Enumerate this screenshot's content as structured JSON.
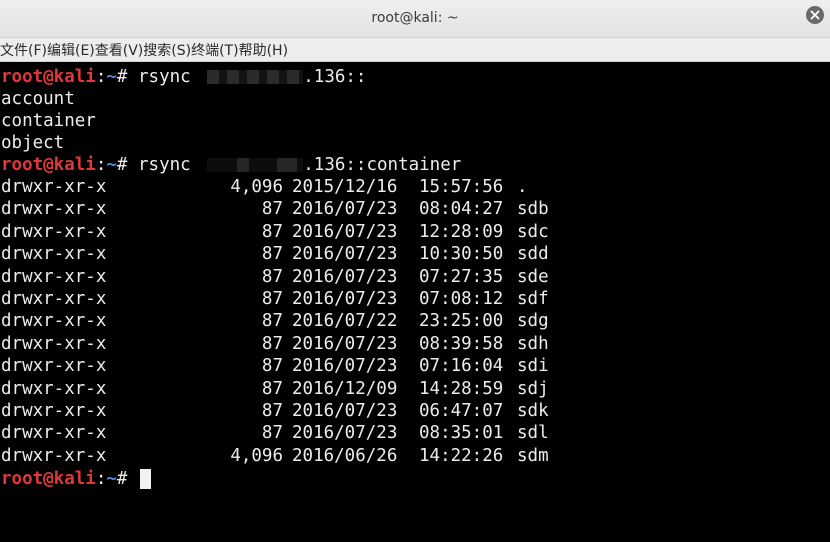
{
  "window": {
    "title": "root@kali: ~"
  },
  "menu": [
    {
      "label": "文件(F)"
    },
    {
      "label": "编辑(E)"
    },
    {
      "label": "查看(V)"
    },
    {
      "label": "搜索(S)"
    },
    {
      "label": "终端(T)"
    },
    {
      "label": "帮助(H)"
    }
  ],
  "prompt": {
    "user": "root@kali",
    "sep": ":",
    "path": "~",
    "symbol": "#"
  },
  "commands": [
    {
      "cmd": "rsync",
      "after_redaction": ".136::"
    },
    {
      "cmd": "rsync",
      "after_redaction": ".136::container"
    }
  ],
  "modules": [
    "account",
    "container",
    "object"
  ],
  "listing": [
    {
      "perms": "drwxr-xr-x",
      "size": "4,096",
      "date": "2015/12/16",
      "time": "15:57:56",
      "name": "."
    },
    {
      "perms": "drwxr-xr-x",
      "size": "87",
      "date": "2016/07/23",
      "time": "08:04:27",
      "name": "sdb"
    },
    {
      "perms": "drwxr-xr-x",
      "size": "87",
      "date": "2016/07/23",
      "time": "12:28:09",
      "name": "sdc"
    },
    {
      "perms": "drwxr-xr-x",
      "size": "87",
      "date": "2016/07/23",
      "time": "10:30:50",
      "name": "sdd"
    },
    {
      "perms": "drwxr-xr-x",
      "size": "87",
      "date": "2016/07/23",
      "time": "07:27:35",
      "name": "sde"
    },
    {
      "perms": "drwxr-xr-x",
      "size": "87",
      "date": "2016/07/23",
      "time": "07:08:12",
      "name": "sdf"
    },
    {
      "perms": "drwxr-xr-x",
      "size": "87",
      "date": "2016/07/22",
      "time": "23:25:00",
      "name": "sdg"
    },
    {
      "perms": "drwxr-xr-x",
      "size": "87",
      "date": "2016/07/23",
      "time": "08:39:58",
      "name": "sdh"
    },
    {
      "perms": "drwxr-xr-x",
      "size": "87",
      "date": "2016/07/23",
      "time": "07:16:04",
      "name": "sdi"
    },
    {
      "perms": "drwxr-xr-x",
      "size": "87",
      "date": "2016/12/09",
      "time": "14:28:59",
      "name": "sdj"
    },
    {
      "perms": "drwxr-xr-x",
      "size": "87",
      "date": "2016/07/23",
      "time": "06:47:07",
      "name": "sdk"
    },
    {
      "perms": "drwxr-xr-x",
      "size": "87",
      "date": "2016/07/23",
      "time": "08:35:01",
      "name": "sdl"
    },
    {
      "perms": "drwxr-xr-x",
      "size": "4,096",
      "date": "2016/06/26",
      "time": "14:22:26",
      "name": "sdm"
    }
  ],
  "colors": {
    "prompt_user": "#e0383a",
    "prompt_path": "#4f86d8",
    "terminal_bg": "#000000",
    "terminal_fg": "#ececec"
  },
  "icons": {
    "close": "close-icon"
  }
}
